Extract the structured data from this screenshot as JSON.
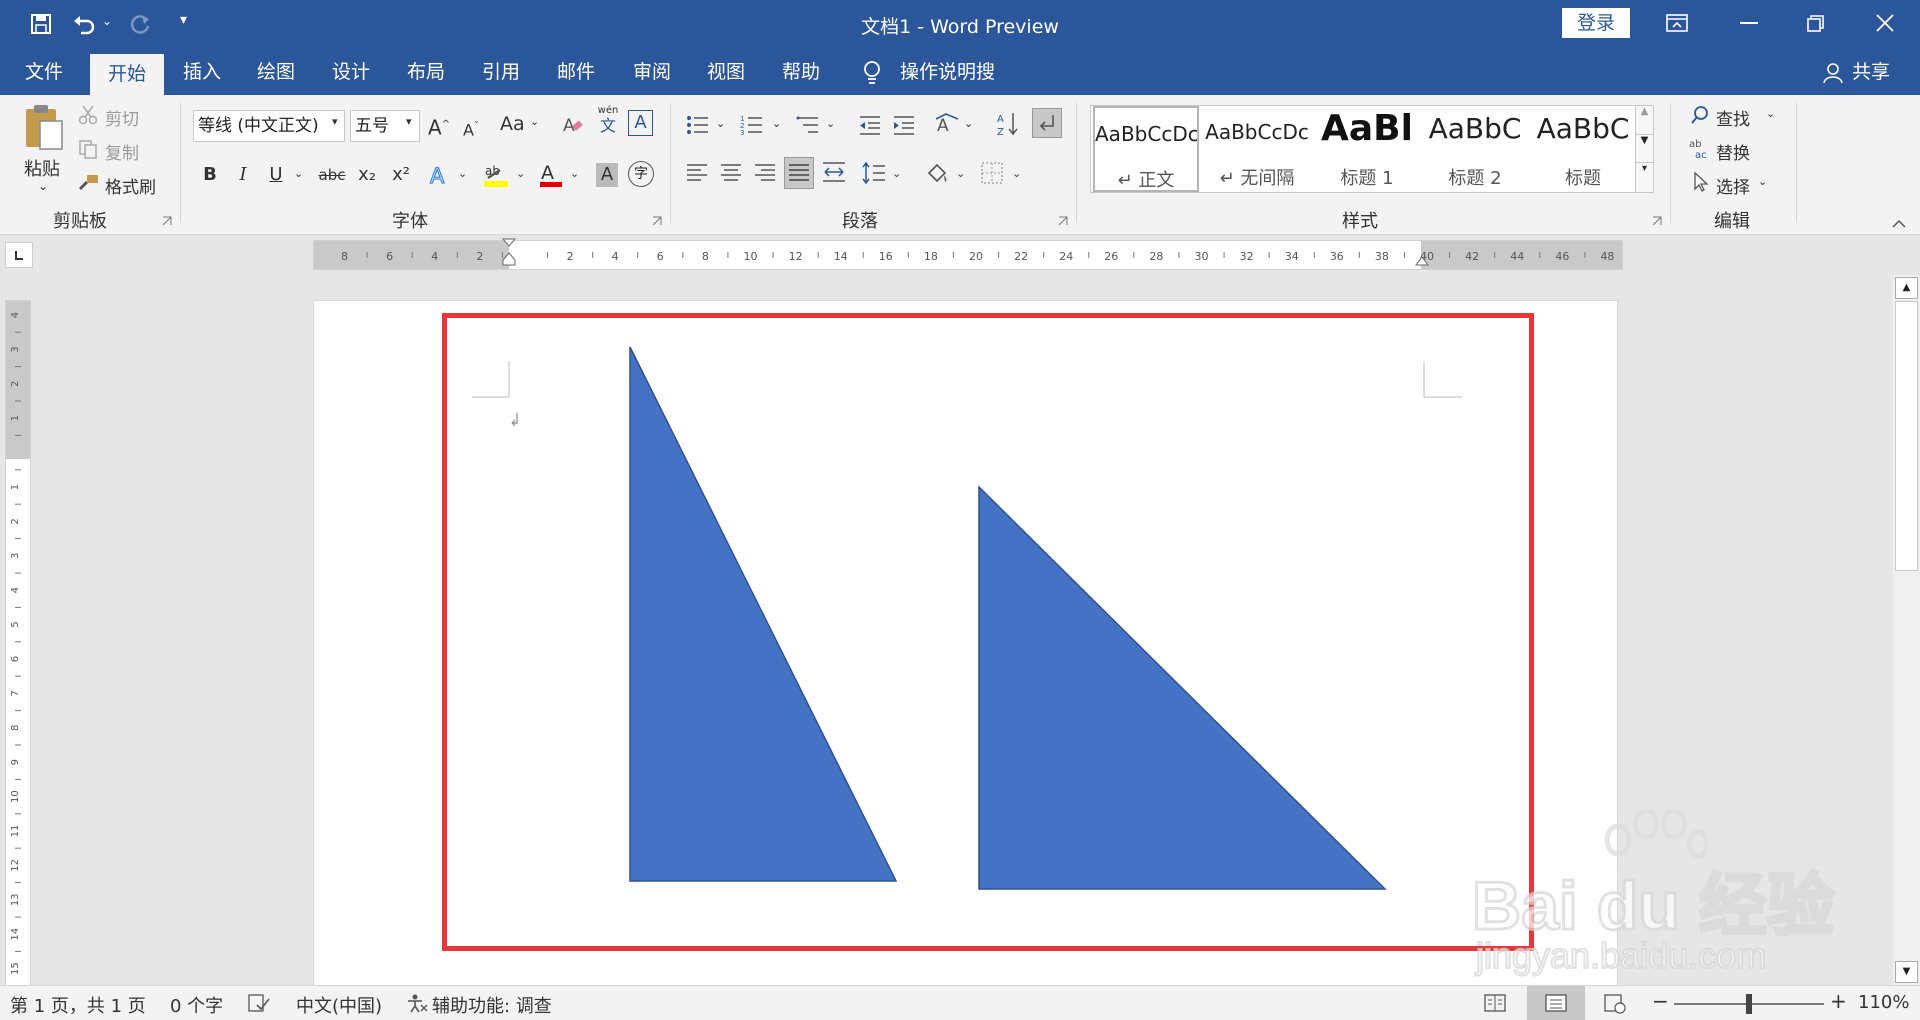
{
  "title": {
    "text": "文档1  -  Word Preview",
    "login": "登录"
  },
  "menu": {
    "tabs": [
      "文件",
      "开始",
      "插入",
      "绘图",
      "设计",
      "布局",
      "引用",
      "邮件",
      "审阅",
      "视图",
      "帮助"
    ],
    "active": "开始",
    "search": "操作说明搜索",
    "share": "共享"
  },
  "clipboard": {
    "paste": "粘贴",
    "cut": "剪切",
    "copy": "复制",
    "format_painter": "格式刷",
    "label": "剪贴板"
  },
  "font": {
    "name": "等线 (中文正文)",
    "size": "五号",
    "label": "字体",
    "case_label": "Aa",
    "phonetic": "wén",
    "phonetic_char": "文",
    "border_char": "A",
    "bold": "B",
    "italic": "I",
    "underline": "U",
    "strike": "abc",
    "sub": "x₂",
    "sup": "x²",
    "enclose_char": "字"
  },
  "paragraph": {
    "label": "段落"
  },
  "styles": {
    "label": "样式",
    "items": [
      {
        "preview": "AaBbCcDc",
        "name": "↵ 正文"
      },
      {
        "preview": "AaBbCcDc",
        "name": "↵ 无间隔"
      },
      {
        "preview": "AaBl",
        "name": "标题 1"
      },
      {
        "preview": "AaBbC",
        "name": "标题 2"
      },
      {
        "preview": "AaBbC",
        "name": "标题"
      }
    ]
  },
  "editing": {
    "find": "查找",
    "replace": "替换",
    "select": "选择",
    "label": "编辑"
  },
  "hruler": {
    "ticks": [
      "8",
      "6",
      "4",
      "2",
      "",
      "2",
      "4",
      "6",
      "8",
      "10",
      "12",
      "14",
      "16",
      "18",
      "20",
      "22",
      "24",
      "26",
      "28",
      "30",
      "32",
      "34",
      "36",
      "38",
      "40",
      "42",
      "44",
      "46",
      "48"
    ]
  },
  "vruler": {
    "ticks": [
      "4",
      "3",
      "2",
      "1",
      "",
      "1",
      "2",
      "3",
      "4",
      "5",
      "6",
      "7",
      "8",
      "9",
      "10",
      "11",
      "12",
      "13",
      "14",
      "15"
    ]
  },
  "status": {
    "page": "第 1 页，共 1 页",
    "words": "0 个字",
    "lang": "中文(中国)",
    "accessibility": "辅助功能: 调查",
    "zoom": "110%",
    "zoom_minus": "−",
    "zoom_plus": "+"
  },
  "watermark": {
    "brand": "Bai du 经验",
    "url": "jingyan.baidu.com"
  },
  "colors": {
    "accent": "#2b579a",
    "shape_fill": "#4472c4",
    "shape_stroke": "#2f528f",
    "highlight_frame": "#e8373a"
  }
}
